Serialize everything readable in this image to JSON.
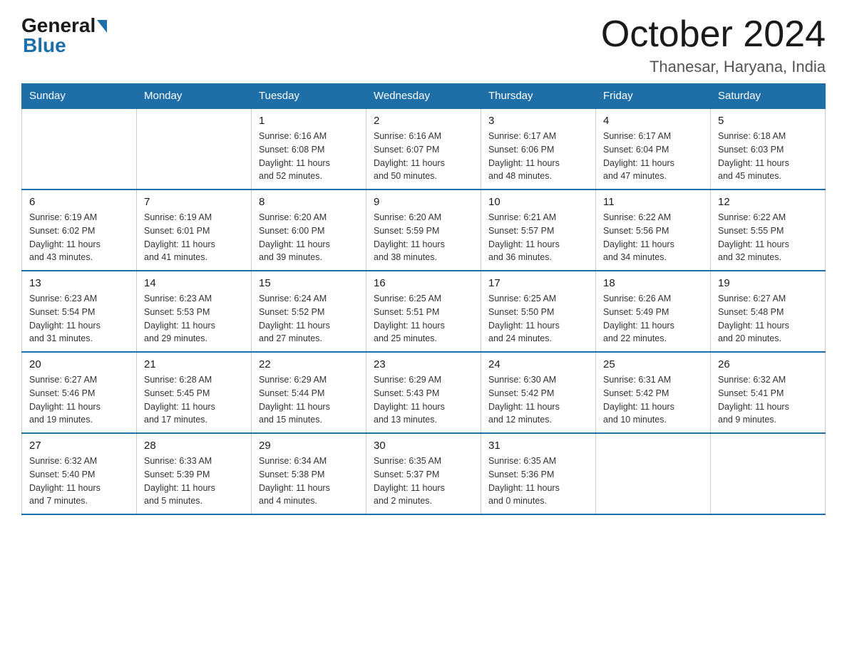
{
  "header": {
    "logo_general": "General",
    "logo_blue": "Blue",
    "month_title": "October 2024",
    "location": "Thanesar, Haryana, India"
  },
  "weekdays": [
    "Sunday",
    "Monday",
    "Tuesday",
    "Wednesday",
    "Thursday",
    "Friday",
    "Saturday"
  ],
  "weeks": [
    [
      {
        "day": "",
        "info": ""
      },
      {
        "day": "",
        "info": ""
      },
      {
        "day": "1",
        "info": "Sunrise: 6:16 AM\nSunset: 6:08 PM\nDaylight: 11 hours\nand 52 minutes."
      },
      {
        "day": "2",
        "info": "Sunrise: 6:16 AM\nSunset: 6:07 PM\nDaylight: 11 hours\nand 50 minutes."
      },
      {
        "day": "3",
        "info": "Sunrise: 6:17 AM\nSunset: 6:06 PM\nDaylight: 11 hours\nand 48 minutes."
      },
      {
        "day": "4",
        "info": "Sunrise: 6:17 AM\nSunset: 6:04 PM\nDaylight: 11 hours\nand 47 minutes."
      },
      {
        "day": "5",
        "info": "Sunrise: 6:18 AM\nSunset: 6:03 PM\nDaylight: 11 hours\nand 45 minutes."
      }
    ],
    [
      {
        "day": "6",
        "info": "Sunrise: 6:19 AM\nSunset: 6:02 PM\nDaylight: 11 hours\nand 43 minutes."
      },
      {
        "day": "7",
        "info": "Sunrise: 6:19 AM\nSunset: 6:01 PM\nDaylight: 11 hours\nand 41 minutes."
      },
      {
        "day": "8",
        "info": "Sunrise: 6:20 AM\nSunset: 6:00 PM\nDaylight: 11 hours\nand 39 minutes."
      },
      {
        "day": "9",
        "info": "Sunrise: 6:20 AM\nSunset: 5:59 PM\nDaylight: 11 hours\nand 38 minutes."
      },
      {
        "day": "10",
        "info": "Sunrise: 6:21 AM\nSunset: 5:57 PM\nDaylight: 11 hours\nand 36 minutes."
      },
      {
        "day": "11",
        "info": "Sunrise: 6:22 AM\nSunset: 5:56 PM\nDaylight: 11 hours\nand 34 minutes."
      },
      {
        "day": "12",
        "info": "Sunrise: 6:22 AM\nSunset: 5:55 PM\nDaylight: 11 hours\nand 32 minutes."
      }
    ],
    [
      {
        "day": "13",
        "info": "Sunrise: 6:23 AM\nSunset: 5:54 PM\nDaylight: 11 hours\nand 31 minutes."
      },
      {
        "day": "14",
        "info": "Sunrise: 6:23 AM\nSunset: 5:53 PM\nDaylight: 11 hours\nand 29 minutes."
      },
      {
        "day": "15",
        "info": "Sunrise: 6:24 AM\nSunset: 5:52 PM\nDaylight: 11 hours\nand 27 minutes."
      },
      {
        "day": "16",
        "info": "Sunrise: 6:25 AM\nSunset: 5:51 PM\nDaylight: 11 hours\nand 25 minutes."
      },
      {
        "day": "17",
        "info": "Sunrise: 6:25 AM\nSunset: 5:50 PM\nDaylight: 11 hours\nand 24 minutes."
      },
      {
        "day": "18",
        "info": "Sunrise: 6:26 AM\nSunset: 5:49 PM\nDaylight: 11 hours\nand 22 minutes."
      },
      {
        "day": "19",
        "info": "Sunrise: 6:27 AM\nSunset: 5:48 PM\nDaylight: 11 hours\nand 20 minutes."
      }
    ],
    [
      {
        "day": "20",
        "info": "Sunrise: 6:27 AM\nSunset: 5:46 PM\nDaylight: 11 hours\nand 19 minutes."
      },
      {
        "day": "21",
        "info": "Sunrise: 6:28 AM\nSunset: 5:45 PM\nDaylight: 11 hours\nand 17 minutes."
      },
      {
        "day": "22",
        "info": "Sunrise: 6:29 AM\nSunset: 5:44 PM\nDaylight: 11 hours\nand 15 minutes."
      },
      {
        "day": "23",
        "info": "Sunrise: 6:29 AM\nSunset: 5:43 PM\nDaylight: 11 hours\nand 13 minutes."
      },
      {
        "day": "24",
        "info": "Sunrise: 6:30 AM\nSunset: 5:42 PM\nDaylight: 11 hours\nand 12 minutes."
      },
      {
        "day": "25",
        "info": "Sunrise: 6:31 AM\nSunset: 5:42 PM\nDaylight: 11 hours\nand 10 minutes."
      },
      {
        "day": "26",
        "info": "Sunrise: 6:32 AM\nSunset: 5:41 PM\nDaylight: 11 hours\nand 9 minutes."
      }
    ],
    [
      {
        "day": "27",
        "info": "Sunrise: 6:32 AM\nSunset: 5:40 PM\nDaylight: 11 hours\nand 7 minutes."
      },
      {
        "day": "28",
        "info": "Sunrise: 6:33 AM\nSunset: 5:39 PM\nDaylight: 11 hours\nand 5 minutes."
      },
      {
        "day": "29",
        "info": "Sunrise: 6:34 AM\nSunset: 5:38 PM\nDaylight: 11 hours\nand 4 minutes."
      },
      {
        "day": "30",
        "info": "Sunrise: 6:35 AM\nSunset: 5:37 PM\nDaylight: 11 hours\nand 2 minutes."
      },
      {
        "day": "31",
        "info": "Sunrise: 6:35 AM\nSunset: 5:36 PM\nDaylight: 11 hours\nand 0 minutes."
      },
      {
        "day": "",
        "info": ""
      },
      {
        "day": "",
        "info": ""
      }
    ]
  ]
}
